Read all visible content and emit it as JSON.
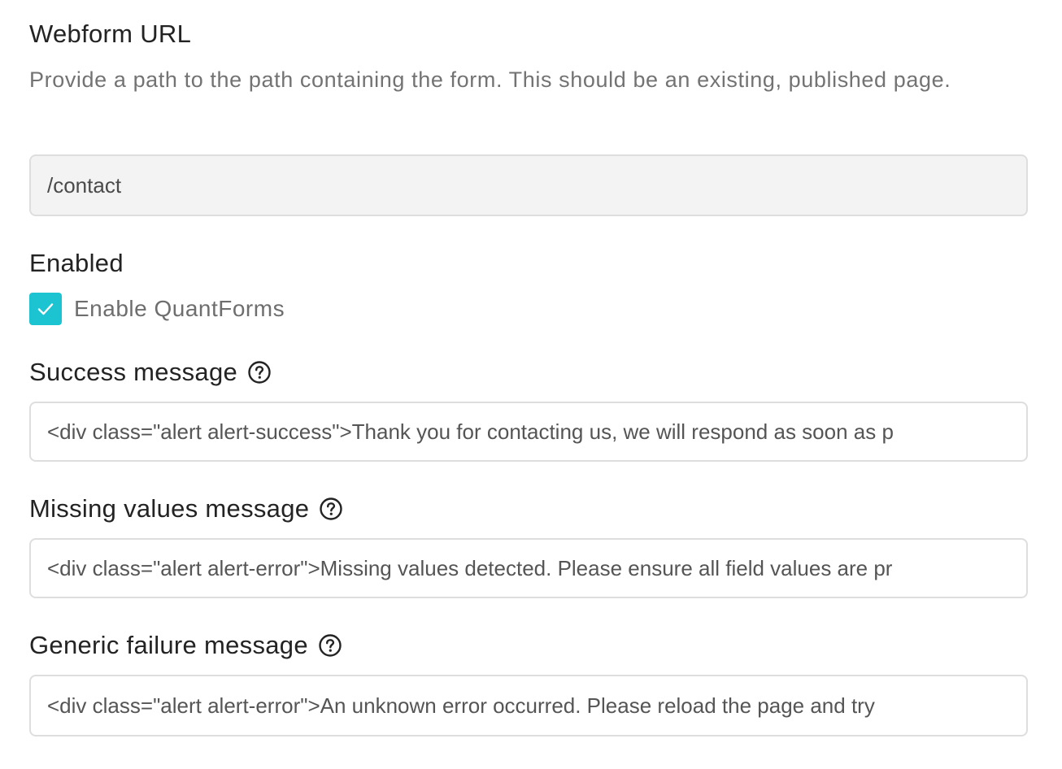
{
  "webform_url": {
    "title": "Webform URL",
    "description": "Provide a path to the path containing the form. This should be an existing, published page.",
    "value": "/contact"
  },
  "enabled": {
    "title": "Enabled",
    "checkbox_label": "Enable QuantForms",
    "checked": true
  },
  "success_message": {
    "title": "Success message",
    "help_icon": "question-circle-icon",
    "value": "<div class=\"alert alert-success\">Thank you for contacting us, we will respond as soon as p"
  },
  "missing_values_message": {
    "title": "Missing values message",
    "help_icon": "question-circle-icon",
    "value": "<div class=\"alert alert-error\">Missing values detected. Please ensure all field values are pr"
  },
  "generic_failure_message": {
    "title": "Generic failure message",
    "help_icon": "question-circle-icon",
    "value": "<div class=\"alert alert-error\">An unknown error occurred. Please reload the page and try"
  },
  "colors": {
    "accent": "#1cc3d1",
    "heading": "#232323",
    "muted": "#737373",
    "border": "#dedede",
    "readonly_bg": "#f3f3f3"
  }
}
